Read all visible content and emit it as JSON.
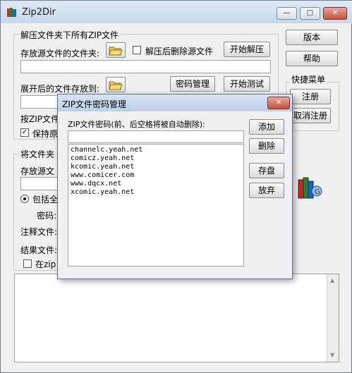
{
  "window": {
    "title": "Zip2Dir",
    "minimize": "—",
    "maximize": "□",
    "close": "✕"
  },
  "extract_group": {
    "title": "解压文件夹下所有ZIP文件",
    "source_folder_label": "存放源文件的文件夹:",
    "delete_after_label": "解压后删除源文件",
    "start_extract": "开始解压",
    "dest_folder_label": "展开后的文件存放到:",
    "password_manage": "密码管理",
    "start_test": "开始测试",
    "zip_label_partial": "按ZIP文件",
    "keep_label_partial": "保持原",
    "keep_checked": "✓"
  },
  "compress_group": {
    "title_partial": "将文件夹",
    "source_label_partial": "存放源文",
    "include_all_partial": "包括全",
    "password_label_partial": "密码:",
    "comment_label_partial": "注释文件:",
    "result_label_partial": "结果文件:",
    "in_zip_partial": "在zip"
  },
  "side": {
    "version": "版本",
    "help": "帮助",
    "quick_menu_title": "快捷菜单",
    "register": "注册",
    "unregister": "取消注册"
  },
  "dialog": {
    "title": "ZIP文件密码管理",
    "close": "✕",
    "password_label": "ZIP文件密码(前、后空格将被自动删除):",
    "password_value": "",
    "add": "添加",
    "delete": "删除",
    "save": "存盘",
    "discard": "放弃",
    "passwords": [
      "channelc.yeah.net",
      "comicz.yeah.net",
      "kcomic.yeah.net",
      "www.comicer.com",
      "www.dqcx.net",
      "xcomic.yeah.net"
    ]
  },
  "icons": {
    "app": "zip-books-icon",
    "folder": "open-folder-icon",
    "books": "books-icon"
  }
}
